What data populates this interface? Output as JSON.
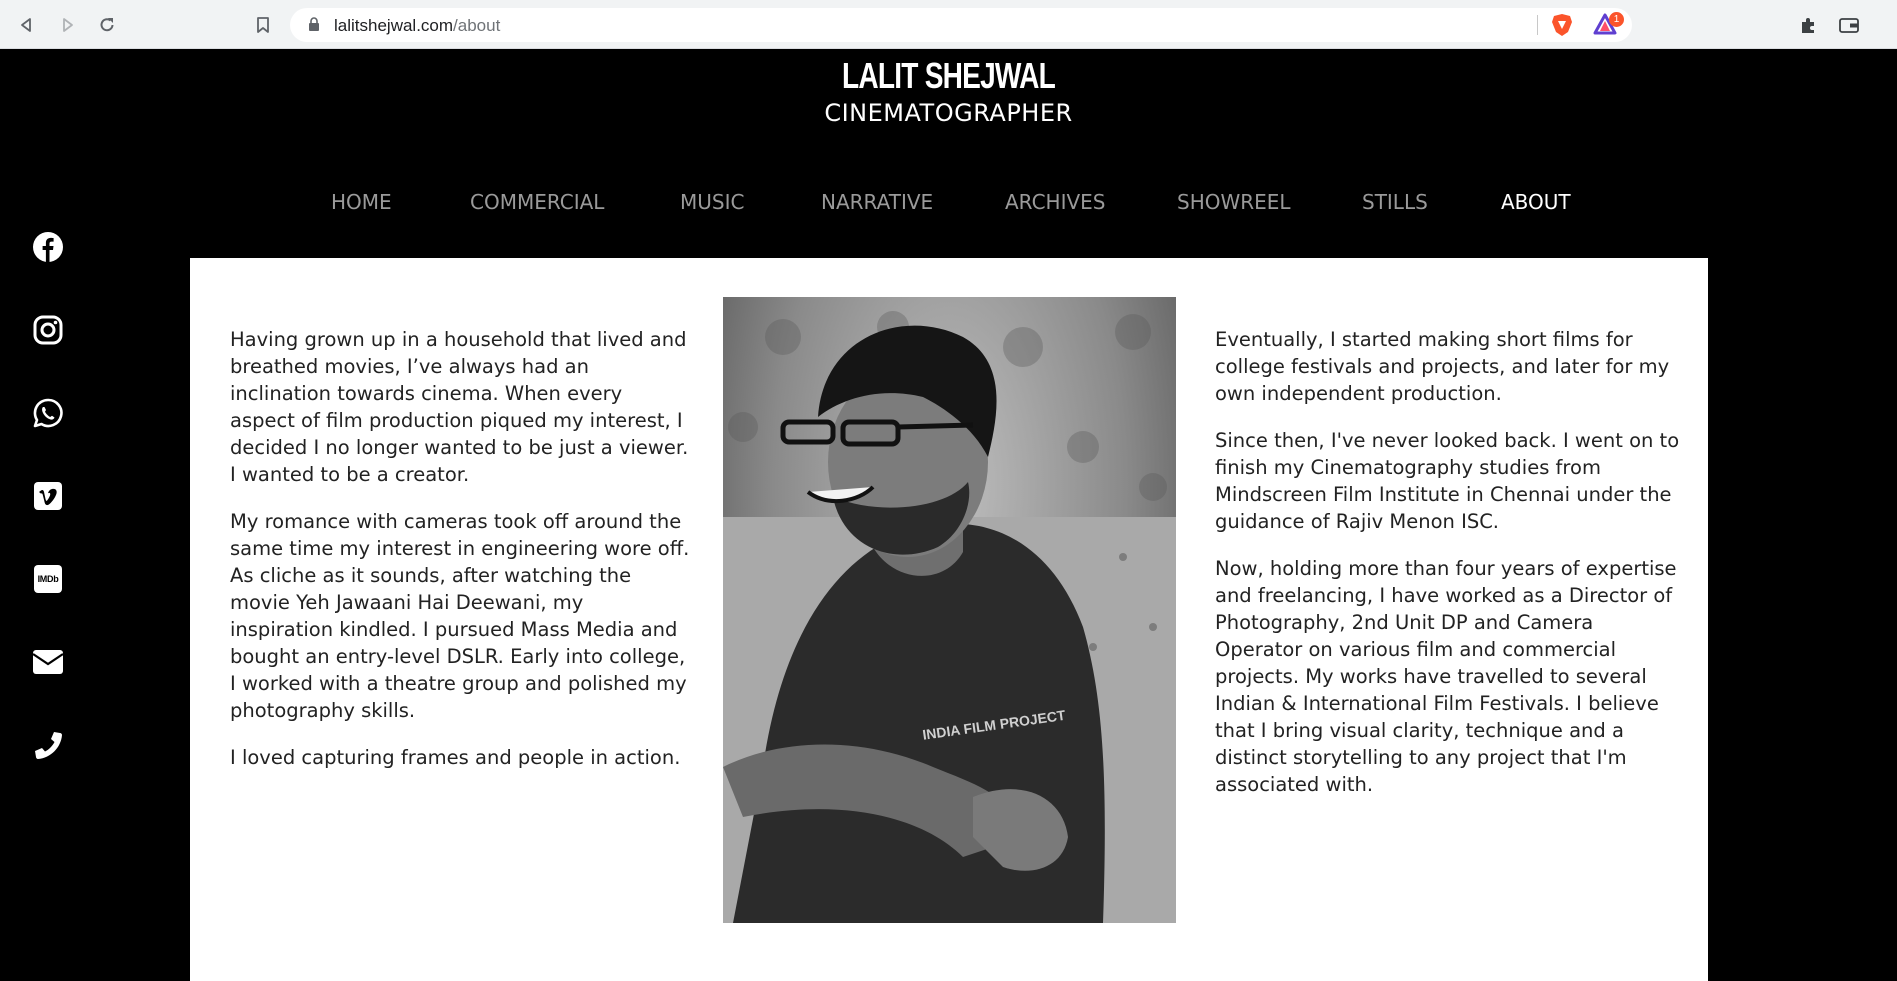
{
  "browser": {
    "url_domain": "lalitshejwal.com",
    "url_path": "/about",
    "notification_badge": "1"
  },
  "header": {
    "brand_name": "LALIT SHEJWAL",
    "tagline": "CINEMATOGRAPHER"
  },
  "nav": {
    "items": [
      {
        "label": "HOME"
      },
      {
        "label": "COMMERCIAL"
      },
      {
        "label": "MUSIC"
      },
      {
        "label": "NARRATIVE"
      },
      {
        "label": "ARCHIVES"
      },
      {
        "label": "SHOWREEL"
      },
      {
        "label": "STILLS"
      },
      {
        "label": "ABOUT",
        "active": true
      }
    ]
  },
  "social": {
    "icons": [
      "facebook-icon",
      "instagram-icon",
      "whatsapp-icon",
      "vimeo-icon",
      "imdb-icon",
      "email-icon",
      "phone-icon"
    ],
    "imdb_text": "IMDb"
  },
  "about": {
    "left": [
      "Having grown up in a household that lived and breathed movies, I’ve always had an inclination towards cinema. When every aspect of film production piqued my interest, I decided I no longer wanted to be just a viewer. I wanted to be a creator.",
      "My romance with cameras took off around the same time my interest in engineering wore off. As cliche as it sounds, after watching the movie Yeh Jawaani Hai Deewani, my inspiration kindled. I pursued Mass Media and bought an entry-level DSLR. Early into college, I worked with a theatre group and polished my photography skills.",
      "I loved capturing frames and people in action."
    ],
    "right": [
      "Eventually, I started making short films for college festivals and projects, and later for my own independent production.",
      "Since then, I've never looked back. I went on to finish my Cinematography studies from Mindscreen Film Institute in Chennai under the guidance of Rajiv Menon ISC.",
      "Now, holding more than four years of expertise and freelancing, I have worked as a Director of Photography, 2nd Unit DP and Camera Operator on various film and commercial projects. My works have travelled to several Indian & International Film Festivals. I believe that I bring visual clarity, technique and a distinct storytelling to any project that I'm associated with."
    ],
    "photo_shirt_text": "INDIA FILM PROJECT"
  }
}
